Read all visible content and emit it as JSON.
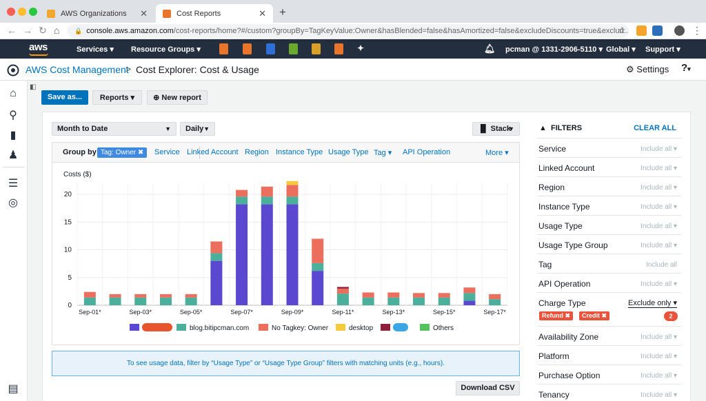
{
  "browser": {
    "tabs": [
      {
        "title": "AWS Organizations",
        "active": false
      },
      {
        "title": "Cost Reports",
        "active": true
      }
    ],
    "url_host": "console.aws.amazon.com",
    "url_path": "/cost-reports/home?#/custom?groupBy=TagKeyValue:Owner&hasBlended=false&hasAmortized=false&excludeDiscounts=true&exclud..."
  },
  "aws_nav": {
    "logo": "aws",
    "services": "Services",
    "resource_groups": "Resource Groups",
    "account": "pcman @ 1331-2906-5110",
    "region": "Global",
    "support": "Support"
  },
  "app_header": {
    "service": "AWS Cost Management",
    "separator": ">",
    "page": "Cost Explorer: Cost & Usage",
    "settings": "Settings"
  },
  "toolbar": {
    "save_as": "Save as...",
    "reports": "Reports",
    "new_report": "New report"
  },
  "controls": {
    "date_range": "Month to Date",
    "granularity": "Daily",
    "chart_style": "Stack"
  },
  "group_by": {
    "label": "Group by:",
    "active_tag": "Tag: Owner",
    "options": [
      "Service",
      "Linked Account",
      "Region",
      "Instance Type",
      "Usage Type",
      "Tag"
    ],
    "api_operation": "API Operation",
    "more": "More"
  },
  "chart_data": {
    "type": "bar",
    "stacked": true,
    "ylabel": "Costs ($)",
    "ylim": [
      0,
      22
    ],
    "yticks": [
      0,
      5,
      10,
      15,
      20
    ],
    "categories": [
      "Sep-01",
      "Sep-02",
      "Sep-03",
      "Sep-04",
      "Sep-05",
      "Sep-06",
      "Sep-07",
      "Sep-08",
      "Sep-09",
      "Sep-10",
      "Sep-11",
      "Sep-12",
      "Sep-13",
      "Sep-14",
      "Sep-15",
      "Sep-16",
      "Sep-17"
    ],
    "tick_labels": [
      "Sep-01*",
      "",
      "Sep-03*",
      "",
      "Sep-05*",
      "",
      "Sep-07*",
      "",
      "Sep-09*",
      "",
      "Sep-11*",
      "",
      "Sep-13*",
      "",
      "Sep-15*",
      "",
      "Sep-17*"
    ],
    "series": [
      {
        "name": "",
        "color": "#5a48d0",
        "redacted": true,
        "values": [
          0,
          0,
          0,
          0,
          0,
          8,
          18.2,
          18.2,
          18.2,
          6.2,
          0,
          0,
          0,
          0,
          0,
          0.8,
          0
        ]
      },
      {
        "name": "blog.bitipcman.com",
        "color": "#4caf9c",
        "values": [
          1.4,
          1.4,
          1.4,
          1.4,
          1.4,
          1.4,
          1.4,
          1.4,
          1.4,
          1.4,
          2.1,
          1.4,
          1.4,
          1.4,
          1.4,
          1.4,
          1.1
        ]
      },
      {
        "name": "No Tagkey: Owner",
        "color": "#ec6f5e",
        "values": [
          1.0,
          0.6,
          0.6,
          0.6,
          0.6,
          2.1,
          1.2,
          1.8,
          2.1,
          4.4,
          0.9,
          0.9,
          0.9,
          0.8,
          0.8,
          1.0,
          0.9
        ]
      },
      {
        "name": "desktop",
        "color": "#f5cb3b",
        "values": [
          0,
          0,
          0,
          0,
          0,
          0,
          0,
          0,
          0.7,
          0,
          0,
          0,
          0,
          0,
          0,
          0,
          0
        ]
      },
      {
        "name": "",
        "color": "#8e1f3c",
        "redacted": true,
        "values": [
          0,
          0,
          0,
          0,
          0,
          0,
          0,
          0,
          0,
          0,
          0.3,
          0,
          0,
          0,
          0,
          0,
          0
        ]
      },
      {
        "name": "Others",
        "color": "#55c15c",
        "values": [
          0,
          0,
          0,
          0,
          0,
          0,
          0,
          0,
          0,
          0,
          0,
          0,
          0,
          0,
          0,
          0,
          0
        ]
      }
    ]
  },
  "notice": "To see usage data, filter by “Usage Type” or “Usage Type Group” filters with matching units (e.g., hours).",
  "download_csv": "Download CSV",
  "filters": {
    "title": "FILTERS",
    "clear_all": "CLEAR ALL",
    "rows": [
      {
        "name": "Service",
        "value": "Include all"
      },
      {
        "name": "Linked Account",
        "value": "Include all"
      },
      {
        "name": "Region",
        "value": "Include all"
      },
      {
        "name": "Instance Type",
        "value": "Include all"
      },
      {
        "name": "Usage Type",
        "value": "Include all"
      },
      {
        "name": "Usage Type Group",
        "value": "Include all"
      },
      {
        "name": "Tag",
        "value": "Include all"
      },
      {
        "name": "API Operation",
        "value": "Include all"
      },
      {
        "name": "Charge Type",
        "value": "Exclude only"
      },
      {
        "name": "Availability Zone",
        "value": "Include all"
      },
      {
        "name": "Platform",
        "value": "Include all"
      },
      {
        "name": "Purchase Option",
        "value": "Include all"
      },
      {
        "name": "Tenancy",
        "value": "Include all"
      }
    ],
    "charge_type_chips": [
      "Refund",
      "Credit"
    ],
    "charge_type_count": "2"
  },
  "colors": {
    "primary": "#0073bb",
    "nav_bg": "#232f3e",
    "accent": "#ff9900",
    "danger": "#e9533b"
  }
}
